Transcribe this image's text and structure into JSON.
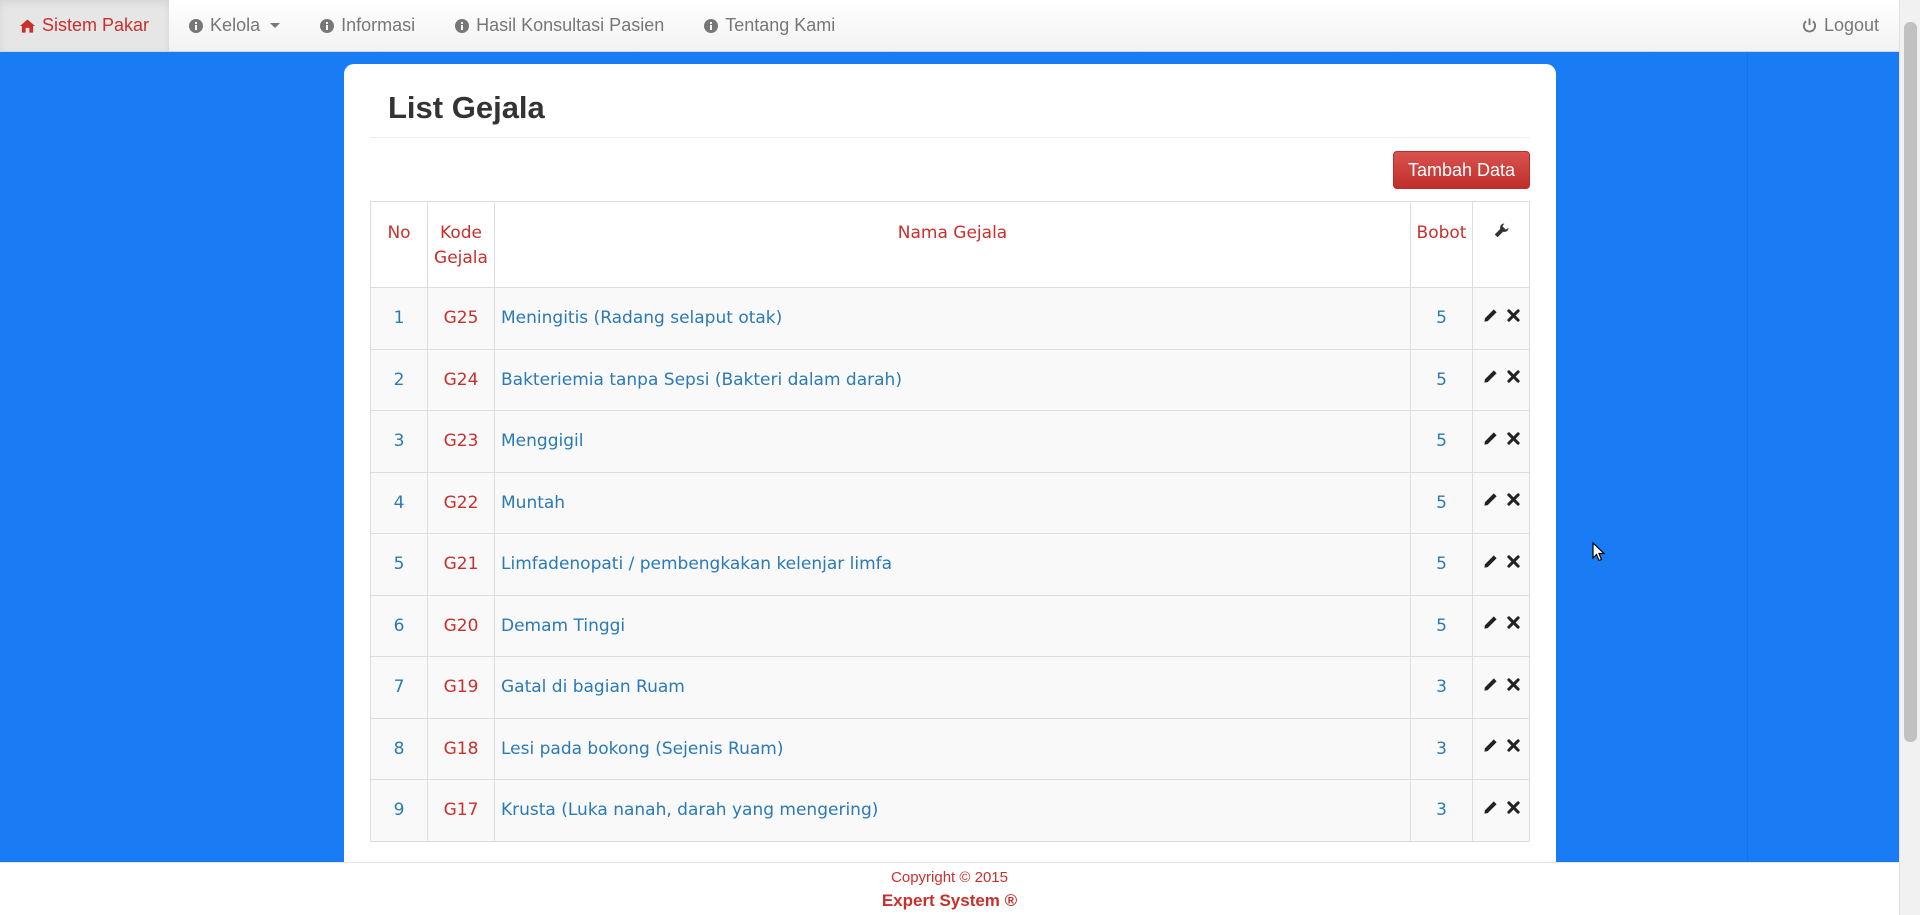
{
  "navbar": {
    "brand": "Sistem Pakar",
    "items": [
      {
        "label": "Kelola"
      },
      {
        "label": "Informasi"
      },
      {
        "label": "Hasil Konsultasi Pasien"
      },
      {
        "label": "Tentang Kami"
      }
    ],
    "logout": "Logout"
  },
  "page": {
    "title": "List Gejala",
    "add_button": "Tambah Data"
  },
  "table": {
    "headers": {
      "no": "No",
      "code_line1": "Kode",
      "code_line2": "Gejala",
      "name": "Nama Gejala",
      "weight": "Bobot",
      "actions_icon": "wrench-icon"
    },
    "rows": [
      {
        "no": "1",
        "code": "G25",
        "name": "Meningitis (Radang selaput otak)",
        "weight": "5"
      },
      {
        "no": "2",
        "code": "G24",
        "name": "Bakteriemia tanpa Sepsi (Bakteri dalam darah)",
        "weight": "5"
      },
      {
        "no": "3",
        "code": "G23",
        "name": "Menggigil",
        "weight": "5"
      },
      {
        "no": "4",
        "code": "G22",
        "name": "Muntah",
        "weight": "5"
      },
      {
        "no": "5",
        "code": "G21",
        "name": "Limfadenopati / pembengkakan kelenjar limfa",
        "weight": "5"
      },
      {
        "no": "6",
        "code": "G20",
        "name": "Demam Tinggi",
        "weight": "5"
      },
      {
        "no": "7",
        "code": "G19",
        "name": "Gatal di bagian Ruam",
        "weight": "3"
      },
      {
        "no": "8",
        "code": "G18",
        "name": "Lesi pada bokong (Sejenis Ruam)",
        "weight": "3"
      },
      {
        "no": "9",
        "code": "G17",
        "name": "Krusta (Luka nanah, darah yang mengering)",
        "weight": "3"
      }
    ]
  },
  "footer": {
    "copyright": "Copyright © 2015",
    "brand": "Expert System ®"
  },
  "colors": {
    "background": "#1a7cf5",
    "accent_red": "#c9302c",
    "link_blue": "#2a7ab7"
  }
}
